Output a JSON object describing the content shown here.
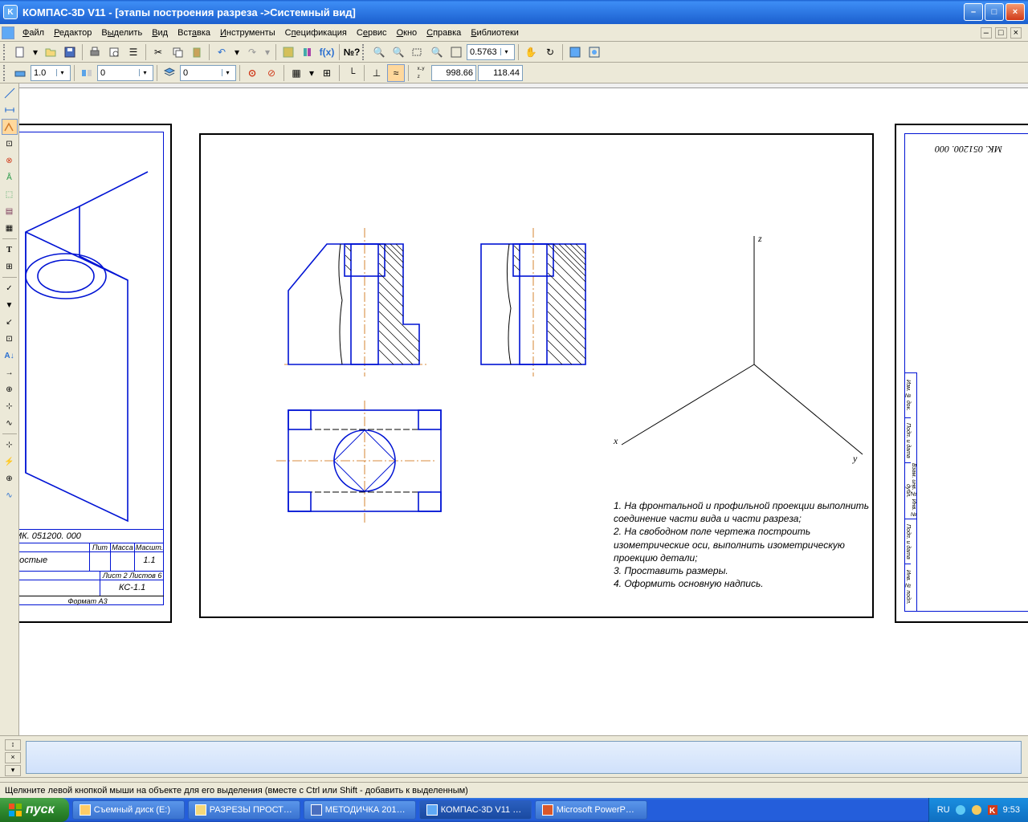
{
  "title": "КОМПАС-3D V11 - [этапы построения разреза ->Системный вид]",
  "menu": [
    "Файл",
    "Редактор",
    "Выделить",
    "Вид",
    "Вставка",
    "Инструменты",
    "Спецификация",
    "Сервис",
    "Окно",
    "Справка",
    "Библиотеки"
  ],
  "toolbar2": {
    "zoom_value": "0.5763"
  },
  "toolbar3": {
    "scale": "1.0",
    "field2": "0",
    "layer": "0",
    "coord_x": "998.66",
    "coord_y": "118.44"
  },
  "drawing": {
    "left_title": "МК. 051200. 000",
    "left_label": "ростые",
    "left_cell_num": "1.1",
    "left_code": "КС-1.1",
    "left_format": "Формат    А3",
    "left_cols": [
      "Пит",
      "Масса",
      "Масшт."
    ],
    "left_sheet": "Лист   2   Листов   6",
    "right_title": "МК. 051200. 000",
    "axes": {
      "x": "x",
      "y": "y",
      "z": "z"
    },
    "notes": [
      "1. На фронтальной и профильной проекции выполнить",
      "   соединение части вида и части разреза;",
      "2. На свободном поле чертежа построить",
      "изометрические оси, выполнить изометрическую",
      "   проекцию детали;",
      "3. Проставить размеры.",
      "4. Оформить основную надпись."
    ]
  },
  "status": "Щелкните левой кнопкой мыши на объекте для его выделения (вместе с Ctrl или Shift - добавить к выделенным)",
  "taskbar": {
    "start": "пуск",
    "tasks": [
      "Съемный диск (E:)",
      "РАЗРЕЗЫ ПРОСТ…",
      "МЕТОДИЧКА 201…",
      "КОМПАС-3D V11 …",
      "Microsoft PowerP…"
    ],
    "lang": "RU",
    "time": "9:53"
  }
}
